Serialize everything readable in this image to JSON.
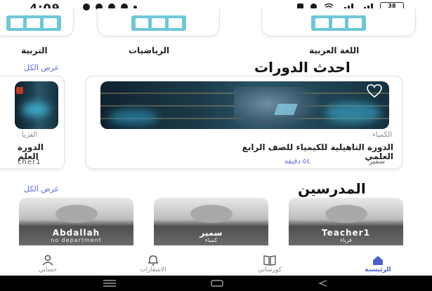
{
  "status_bar": {
    "time": "4:09",
    "battery": "38"
  },
  "subjects": [
    {
      "label": "التربية"
    },
    {
      "label": "الرياضيات"
    },
    {
      "label": "اللغة العربية"
    }
  ],
  "latest_courses": {
    "title": "احدث الدورات",
    "see_all": "عرض الكل",
    "main_card": {
      "category": "الكمياء",
      "title_line1": "الدورة التاهيلية للكيمياء للصف الرابع",
      "title_line2": "العلمي",
      "teacher": "سمير",
      "duration": "٥٤ دقيقة"
    },
    "partial_card": {
      "category": "الفزيا",
      "title_line1": "الدورة",
      "title_line2": "العلم",
      "teacher": "cher1"
    }
  },
  "teachers": {
    "title": "المدرسين",
    "see_all": "عرض الكل",
    "items": [
      {
        "name": "Abdallah",
        "dept": "no department"
      },
      {
        "name": "سمير",
        "dept": "كمياء"
      },
      {
        "name": "Teacher1",
        "dept": "فزياء"
      }
    ]
  },
  "bottom_nav": {
    "items": [
      {
        "label": "حسابي",
        "icon": "person-icon"
      },
      {
        "label": "الاشعارات",
        "icon": "bell-icon"
      },
      {
        "label": "كورساتي",
        "icon": "book-icon"
      },
      {
        "label": "الرئيسية",
        "icon": "home-icon",
        "active": true
      }
    ]
  },
  "colors": {
    "accent": "#5a6fd6",
    "active_nav": "#4b5fd0",
    "subject_illustration": "#6dc7d6"
  }
}
